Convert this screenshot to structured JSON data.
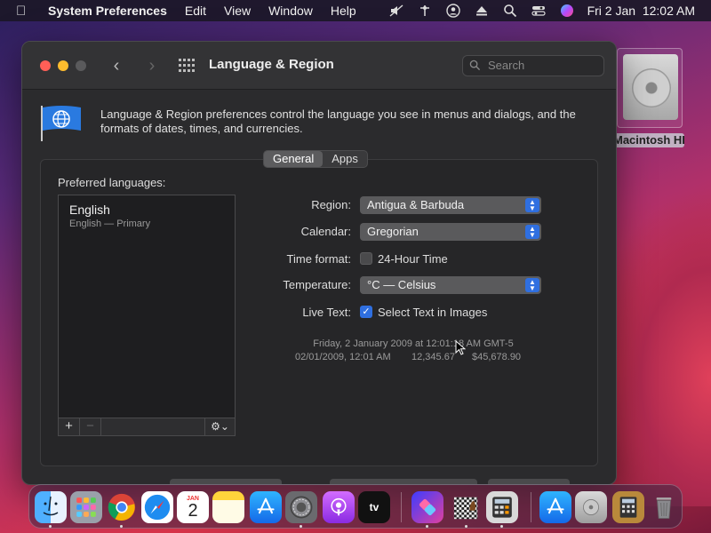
{
  "menubar": {
    "app_name": "System Preferences",
    "menus": [
      "Edit",
      "View",
      "Window",
      "Help"
    ],
    "clock": "Fri 2 Jan  12:02 AM"
  },
  "desktop": {
    "disk_label": "Macintosh HD"
  },
  "window": {
    "title": "Language & Region",
    "search_placeholder": "Search",
    "description": "Language & Region preferences control the language you see in menus and dialogs, and the formats of dates, times, and currencies.",
    "tabs": [
      {
        "label": "General",
        "active": true
      },
      {
        "label": "Apps",
        "active": false
      }
    ],
    "preferred_languages_label": "Preferred languages:",
    "languages": [
      {
        "name": "English",
        "detail": "English — Primary"
      }
    ],
    "list_toolbar": {
      "add": "+",
      "remove": "−",
      "gear": "⚙︎⌄"
    },
    "settings": {
      "region_label": "Region:",
      "region_value": "Antigua & Barbuda",
      "calendar_label": "Calendar:",
      "calendar_value": "Gregorian",
      "time_format_label": "Time format:",
      "time_format_option": "24-Hour Time",
      "time_format_checked": false,
      "temperature_label": "Temperature:",
      "temperature_value": "°C — Celsius",
      "live_text_label": "Live Text:",
      "live_text_option": "Select Text in Images",
      "live_text_checked": true
    },
    "sample": {
      "date_line": "Friday, 2 January 2009 at 12:01:18 AM GMT-5",
      "short_date": "02/01/2009, 12:01 AM",
      "number": "12,345.67",
      "currency": "$45,678.90"
    }
  },
  "colors": {
    "accent": "#2f6fe0",
    "close": "#ff5f57",
    "minimize": "#febc2e"
  },
  "dock": {
    "apps": [
      "finder",
      "launchpad",
      "chrome",
      "safari",
      "calendar",
      "notes",
      "app-store",
      "system-preferences",
      "podcasts",
      "apple-tv",
      "shortcuts",
      "chess",
      "calculator",
      "app-store-downloads",
      "disk",
      "calculator-stack",
      "trash"
    ],
    "calendar_month": "JAN",
    "calendar_day": "2",
    "tv_label": "tv"
  }
}
